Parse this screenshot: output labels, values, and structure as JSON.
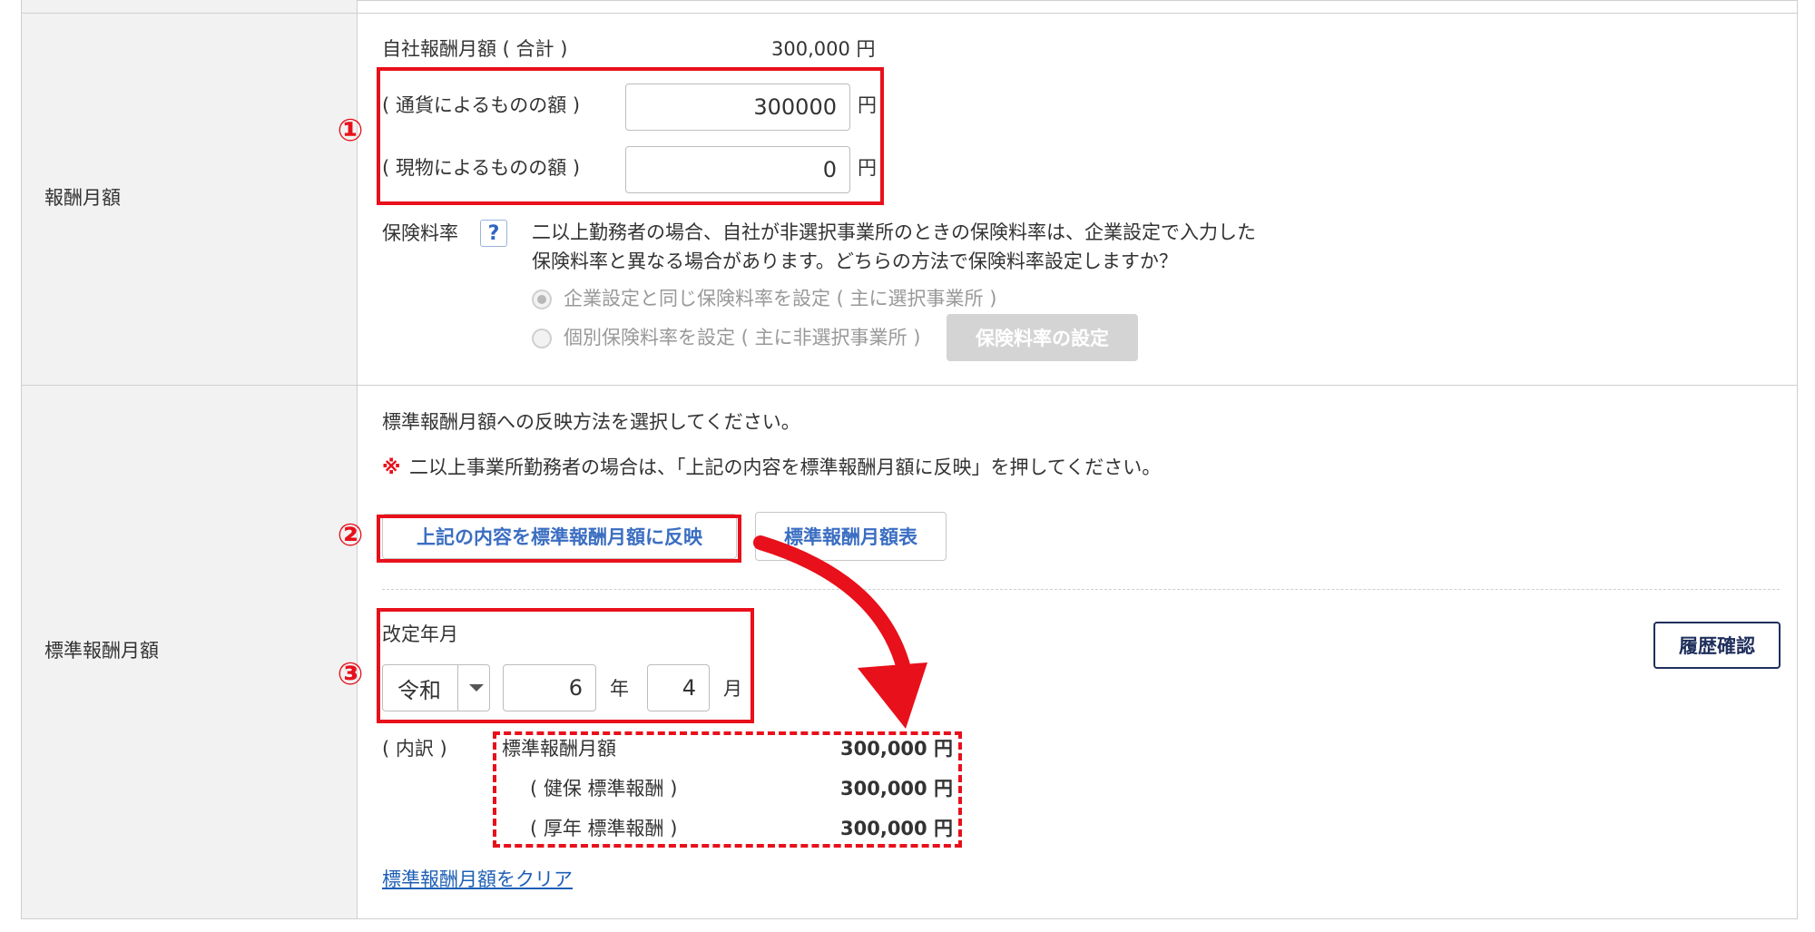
{
  "remuneration": {
    "row_label": "報酬月額",
    "total_label": "自社報酬月額 ( 合計 )",
    "total_value": "300,000 円",
    "cash_label": "( 通貨によるものの額 )",
    "cash_value": "300000",
    "kind_label": "( 現物によるものの額 )",
    "kind_value": "0",
    "unit": "円",
    "rate_label": "保険料率",
    "help_icon": "?",
    "rate_note_line1": "二以上勤務者の場合、自社が非選択事業所のときの保険料率は、企業設定で入力した",
    "rate_note_line2": "保険料率と異なる場合があります。どちらの方法で保険料率設定しますか？",
    "option_same": "企業設定と同じ保険料率を設定 ( 主に選択事業所 )",
    "option_individual": "個別保険料率を設定 ( 主に非選択事業所 )",
    "rate_setting_button": "保険料率の設定"
  },
  "standard": {
    "row_label": "標準報酬月額",
    "instruction": "標準報酬月額への反映方法を選択してください。",
    "note_mark": "※",
    "note_text": "二以上事業所勤務者の場合は、「上記の内容を標準報酬月額に反映」を押してください。",
    "reflect_button": "上記の内容を標準報酬月額に反映",
    "table_button": "標準報酬月額表",
    "revision_label": "改定年月",
    "era_value": "令和",
    "year_value": "6",
    "year_unit": "年",
    "month_value": "4",
    "month_unit": "月",
    "history_button": "履歴確認",
    "breakdown_label": "( 内訳 )",
    "breakdown": [
      {
        "label": "標準報酬月額",
        "value": "300,000 円"
      },
      {
        "label": "( 健保 標準報酬 )",
        "value": "300,000 円"
      },
      {
        "label": "( 厚年 標準報酬 )",
        "value": "300,000 円"
      }
    ],
    "clear_link": "標準報酬月額をクリア"
  },
  "annotations": {
    "step1": "①",
    "step2": "②",
    "step3": "③"
  },
  "colors": {
    "annotation_red": "#e8101b",
    "button_blue": "#3b6ec2",
    "history_navy": "#1f2f5c",
    "link_blue": "#1d5fb6"
  }
}
